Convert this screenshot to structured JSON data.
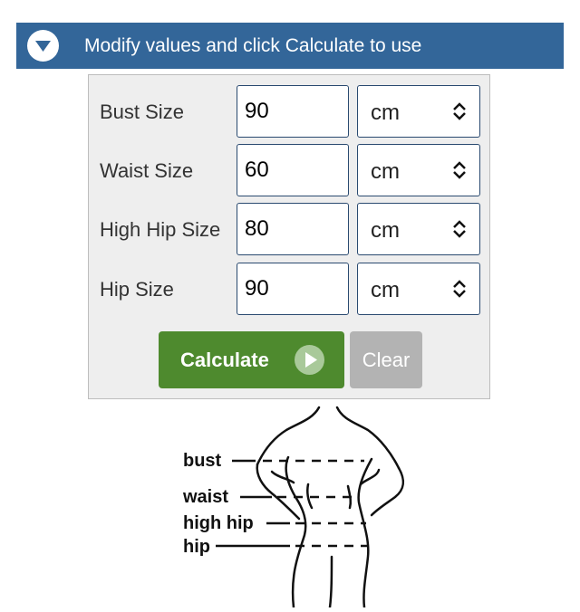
{
  "header": {
    "title": "Modify values and click Calculate to use",
    "toggle_icon": "chevron-down-circle-icon",
    "background": "#336699"
  },
  "form": {
    "rows": [
      {
        "label": "Bust Size",
        "value": "90",
        "unit": "cm"
      },
      {
        "label": "Waist Size",
        "value": "60",
        "unit": "cm"
      },
      {
        "label": "High Hip Size",
        "value": "80",
        "unit": "cm"
      },
      {
        "label": "Hip Size",
        "value": "90",
        "unit": "cm"
      }
    ],
    "select_icon": "up-down-arrows-icon"
  },
  "buttons": {
    "calculate": {
      "label": "Calculate",
      "color": "#4e8a2e",
      "icon": "play-circle-icon"
    },
    "clear": {
      "label": "Clear",
      "color": "#b3b3b3"
    }
  },
  "diagram": {
    "labels": [
      "bust",
      "waist",
      "high hip",
      "hip"
    ]
  }
}
